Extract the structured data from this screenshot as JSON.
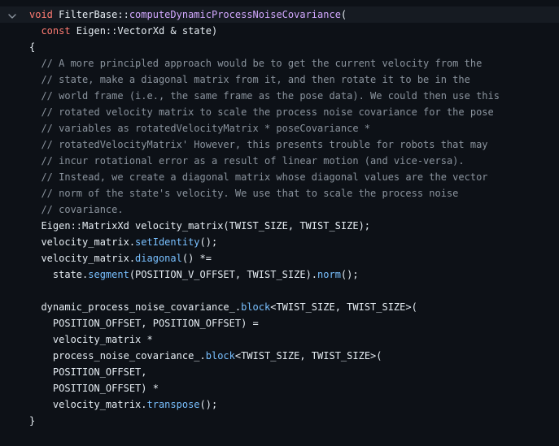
{
  "colors": {
    "background": "#0d1117",
    "highlight_line": "#161b22",
    "keyword": "#ff7b72",
    "function_name": "#d2a8ff",
    "method_call": "#79c0ff",
    "comment": "#8b949e",
    "text": "#e6edf3"
  },
  "fold_icon": "chevron-down-icon",
  "lines": [
    [
      [
        "kw",
        "void"
      ],
      [
        "tx",
        " FilterBase::"
      ],
      [
        "fn",
        "computeDynamicProcessNoiseCovariance"
      ],
      [
        "tx",
        "("
      ]
    ],
    [
      [
        "tx",
        "  "
      ],
      [
        "kw",
        "const"
      ],
      [
        "tx",
        " Eigen::VectorXd & state)"
      ]
    ],
    [
      [
        "tx",
        "{"
      ]
    ],
    [
      [
        "cm",
        "  // A more principled approach would be to get the current velocity from the"
      ]
    ],
    [
      [
        "cm",
        "  // state, make a diagonal matrix from it, and then rotate it to be in the"
      ]
    ],
    [
      [
        "cm",
        "  // world frame (i.e., the same frame as the pose data). We could then use this"
      ]
    ],
    [
      [
        "cm",
        "  // rotated velocity matrix to scale the process noise covariance for the pose"
      ]
    ],
    [
      [
        "cm",
        "  // variables as rotatedVelocityMatrix * poseCovariance *"
      ]
    ],
    [
      [
        "cm",
        "  // rotatedVelocityMatrix' However, this presents trouble for robots that may"
      ]
    ],
    [
      [
        "cm",
        "  // incur rotational error as a result of linear motion (and vice-versa)."
      ]
    ],
    [
      [
        "cm",
        "  // Instead, we create a diagonal matrix whose diagonal values are the vector"
      ]
    ],
    [
      [
        "cm",
        "  // norm of the state's velocity. We use that to scale the process noise"
      ]
    ],
    [
      [
        "cm",
        "  // covariance."
      ]
    ],
    [
      [
        "tx",
        "  Eigen::MatrixXd velocity_matrix(TWIST_SIZE, TWIST_SIZE);"
      ]
    ],
    [
      [
        "tx",
        "  velocity_matrix."
      ],
      [
        "call",
        "setIdentity"
      ],
      [
        "tx",
        "();"
      ]
    ],
    [
      [
        "tx",
        "  velocity_matrix."
      ],
      [
        "call",
        "diagonal"
      ],
      [
        "tx",
        "() *="
      ]
    ],
    [
      [
        "tx",
        "    state."
      ],
      [
        "call",
        "segment"
      ],
      [
        "tx",
        "(POSITION_V_OFFSET, TWIST_SIZE)."
      ],
      [
        "call",
        "norm"
      ],
      [
        "tx",
        "();"
      ]
    ],
    [],
    [
      [
        "tx",
        "  dynamic_process_noise_covariance_."
      ],
      [
        "call",
        "block"
      ],
      [
        "tx",
        "<TWIST_SIZE, TWIST_SIZE>("
      ]
    ],
    [
      [
        "tx",
        "    POSITION_OFFSET, POSITION_OFFSET) ="
      ]
    ],
    [
      [
        "tx",
        "    velocity_matrix *"
      ]
    ],
    [
      [
        "tx",
        "    process_noise_covariance_."
      ],
      [
        "call",
        "block"
      ],
      [
        "tx",
        "<TWIST_SIZE, TWIST_SIZE>("
      ]
    ],
    [
      [
        "tx",
        "    POSITION_OFFSET,"
      ]
    ],
    [
      [
        "tx",
        "    POSITION_OFFSET) *"
      ]
    ],
    [
      [
        "tx",
        "    velocity_matrix."
      ],
      [
        "call",
        "transpose"
      ],
      [
        "tx",
        "();"
      ]
    ],
    [
      [
        "tx",
        "}"
      ]
    ]
  ]
}
